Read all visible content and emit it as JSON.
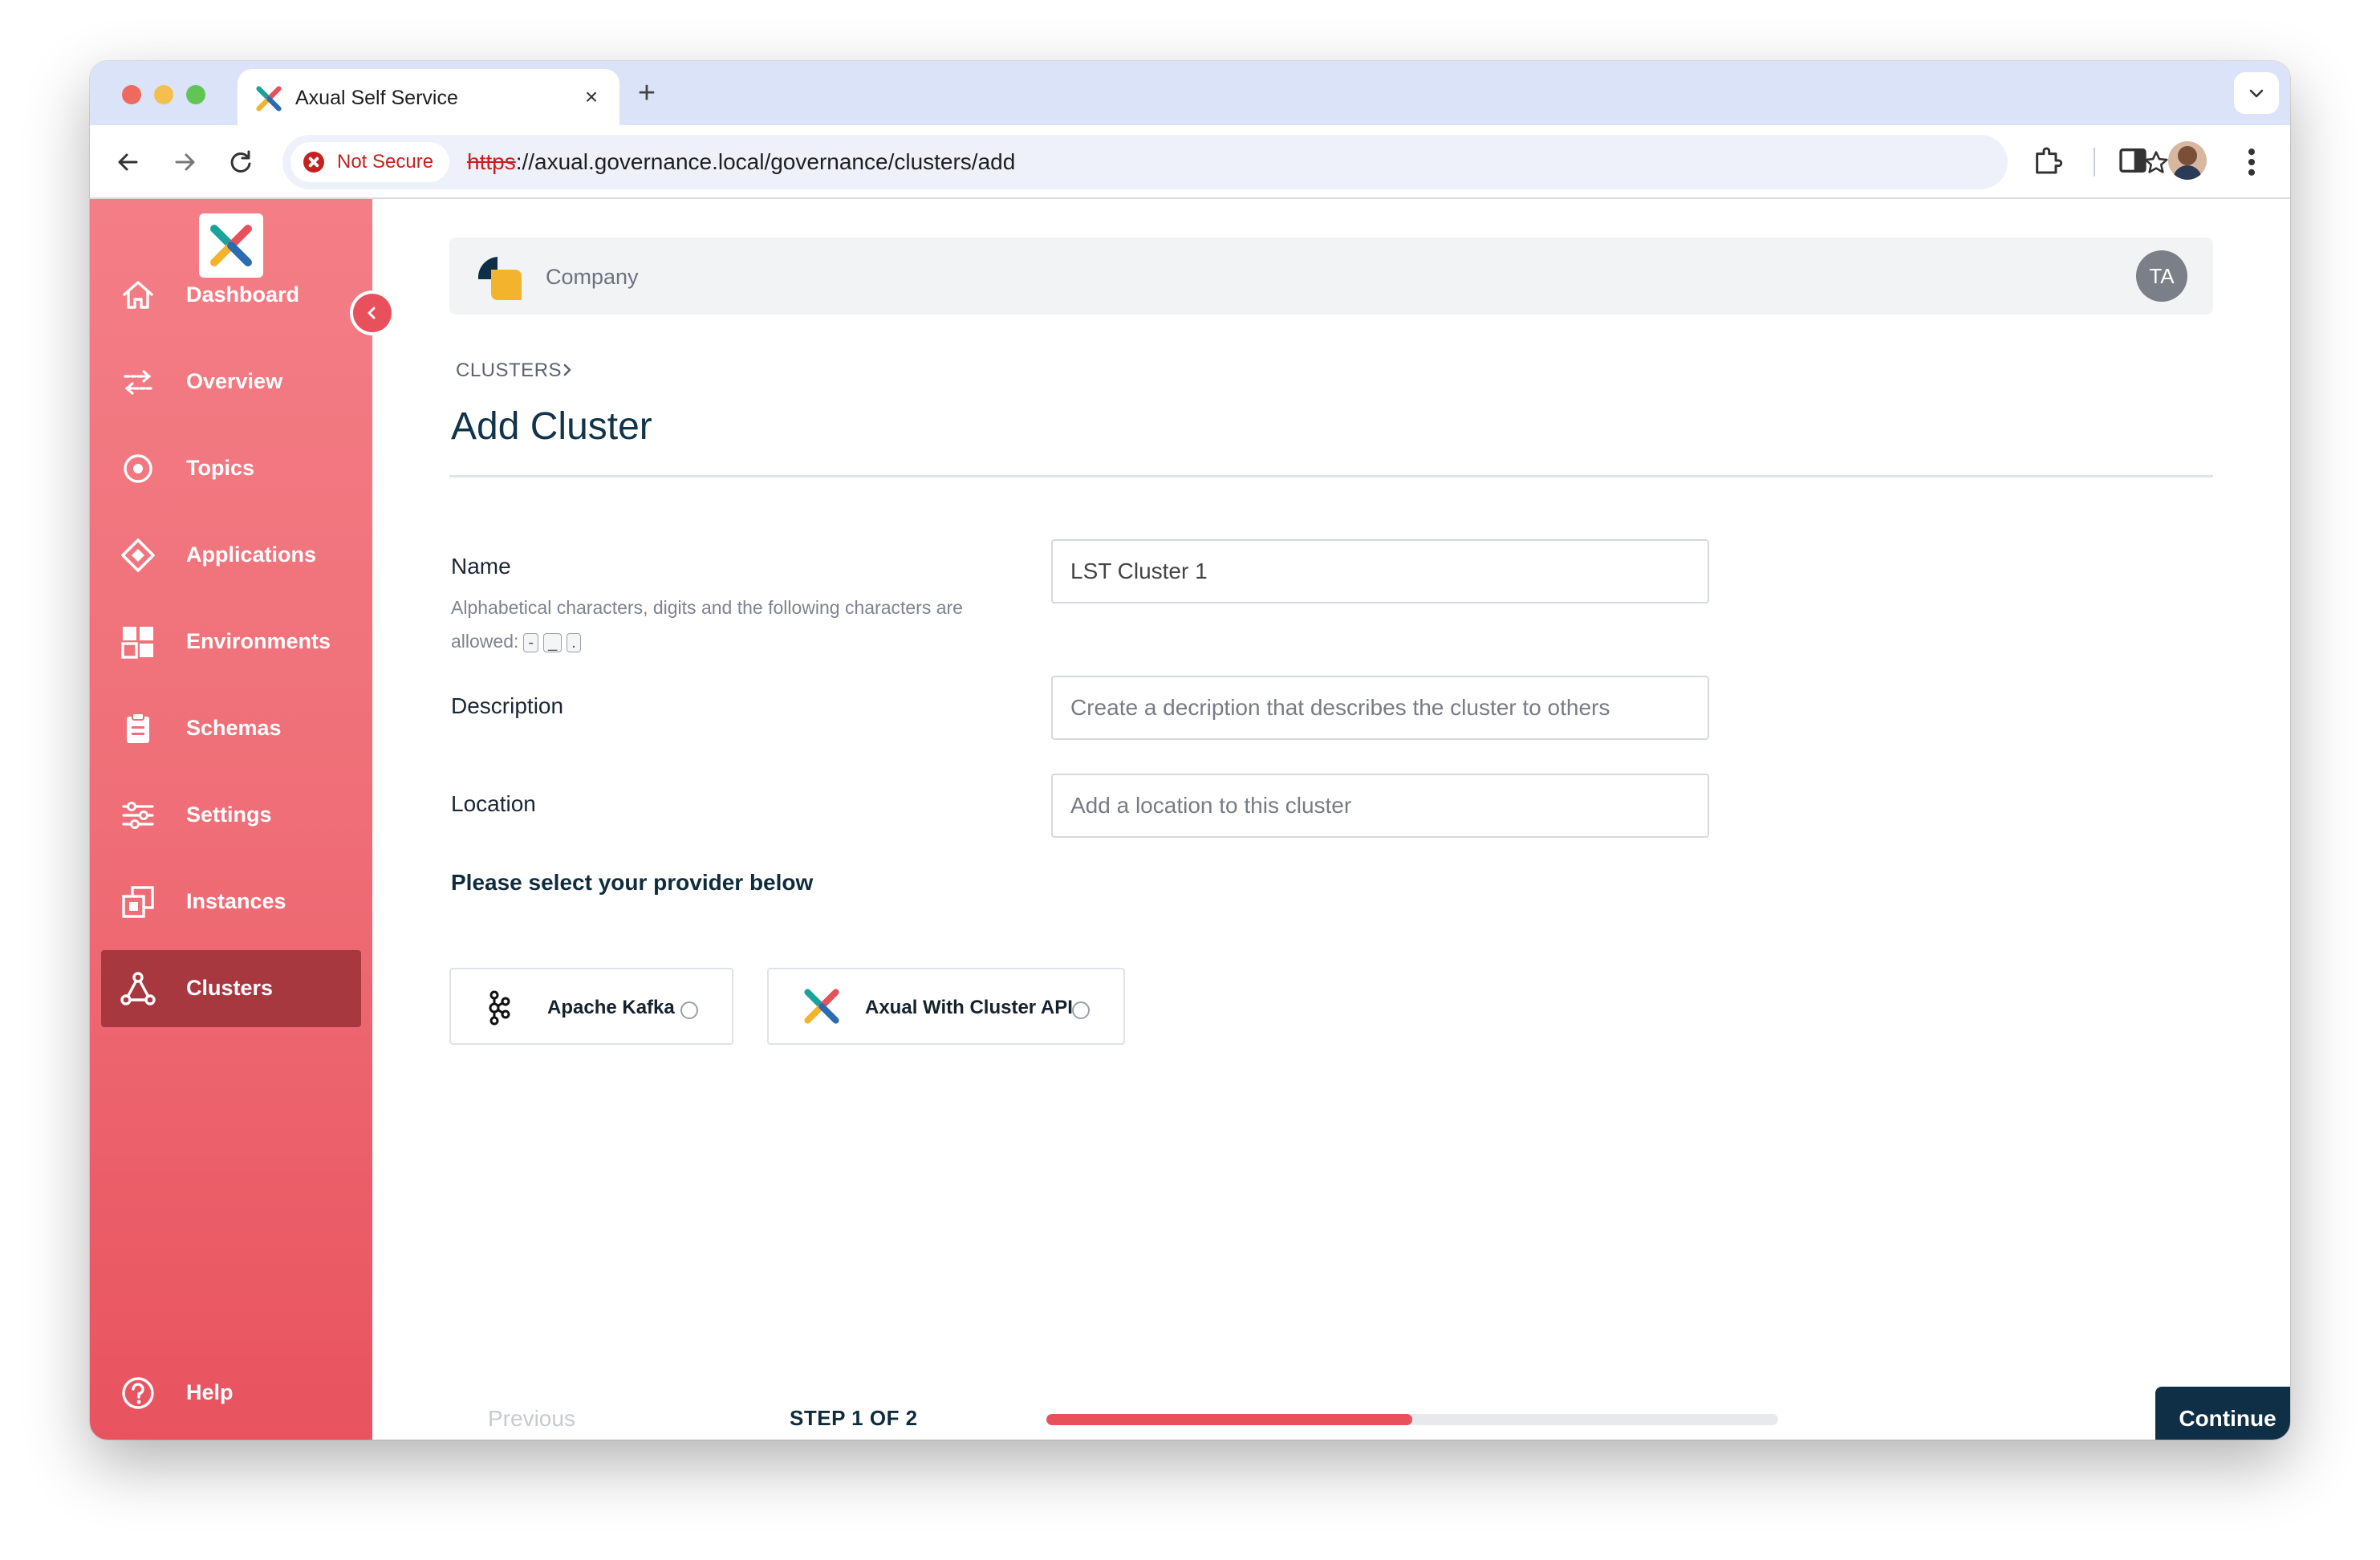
{
  "browser": {
    "tab_title": "Axual Self Service",
    "tab_close": "×",
    "new_tab": "+",
    "security_label": "Not Secure",
    "url_scheme": "https",
    "url_rest": "://axual.governance.local/governance/clusters/add"
  },
  "sidebar": {
    "items": [
      {
        "label": "Dashboard",
        "icon": "home-icon"
      },
      {
        "label": "Overview",
        "icon": "arrows-icon"
      },
      {
        "label": "Topics",
        "icon": "target-icon"
      },
      {
        "label": "Applications",
        "icon": "diamond-icon"
      },
      {
        "label": "Environments",
        "icon": "grid-icon"
      },
      {
        "label": "Schemas",
        "icon": "clipboard-icon"
      },
      {
        "label": "Settings",
        "icon": "sliders-icon"
      },
      {
        "label": "Instances",
        "icon": "instances-icon"
      },
      {
        "label": "Clusters",
        "icon": "cluster-icon",
        "active": true
      }
    ],
    "help_label": "Help"
  },
  "header": {
    "company": "Company",
    "user_initials": "TA"
  },
  "page": {
    "breadcrumb": "CLUSTERS",
    "title": "Add Cluster"
  },
  "form": {
    "name_label": "Name",
    "name_help": "Alphabetical characters, digits and the following characters are allowed:",
    "allowed_chars": [
      "-",
      "_",
      "."
    ],
    "name_value": "LST Cluster 1",
    "description_label": "Description",
    "description_placeholder": "Create a decription that describes the cluster to others",
    "location_label": "Location",
    "location_placeholder": "Add a location to this cluster",
    "provider_heading": "Please select your provider below",
    "providers": [
      {
        "label": "Apache Kafka",
        "icon": "kafka-icon",
        "selected": false
      },
      {
        "label": "Axual With Cluster API",
        "icon": "axual-icon",
        "selected": false
      }
    ]
  },
  "footer": {
    "previous_label": "Previous",
    "step_label": "STEP 1 OF 2",
    "progress": 0.5,
    "continue_label": "Continue"
  },
  "colors": {
    "accent": "#e8505b",
    "primary_button": "#0e2f45",
    "sidebar_active": "#a8383f"
  }
}
